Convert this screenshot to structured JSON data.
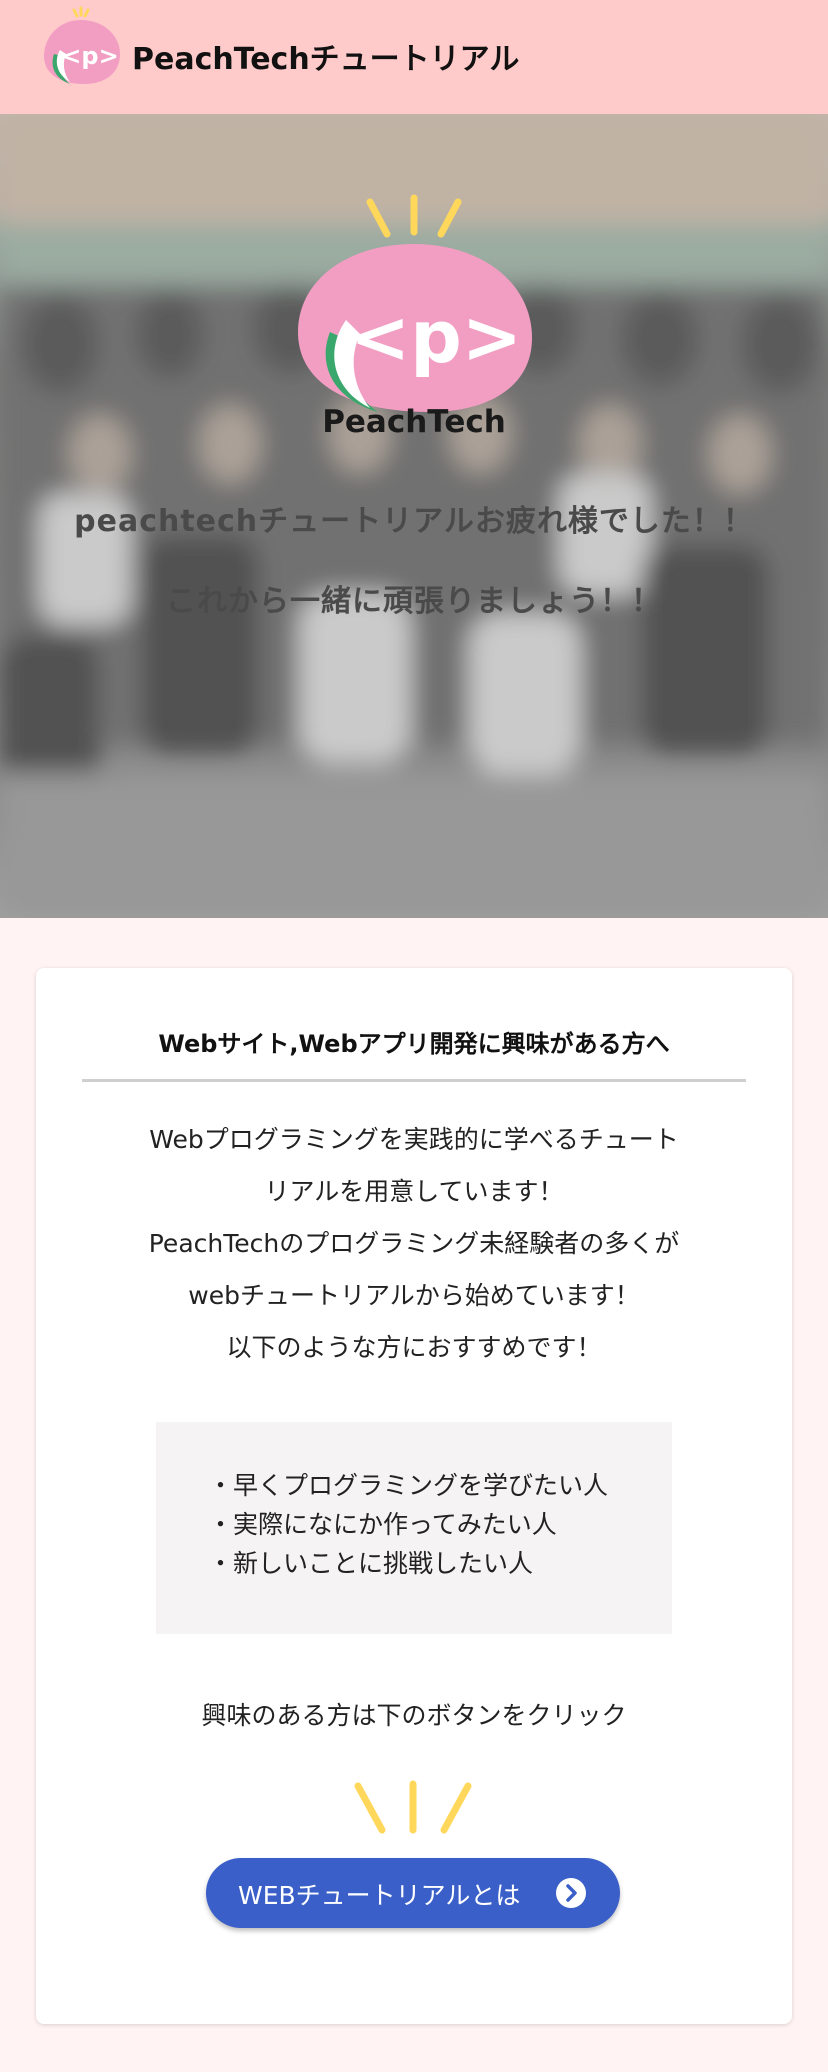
{
  "header": {
    "logo_text": "<p>",
    "title": "PeachTechチュートリアル"
  },
  "hero": {
    "logo_text": "<p>",
    "brand": "PeachTech",
    "message_line1": "peachtechチュートリアルお疲れ様でした！！",
    "message_line2": "これから一緒に頑張りましょう！！"
  },
  "card": {
    "title": "Webサイト,Webアプリ開発に興味がある方へ",
    "description": [
      "Webプログラミングを実践的に学べるチュート",
      "リアルを用意しています！",
      "PeachTechのプログラミング未経験者の多くが",
      "webチュートリアルから始めています！",
      "以下のような方におすすめです！"
    ],
    "recommend_items": [
      "・早くプログラミングを学びたい人",
      "・実際になにか作ってみたい人",
      "・新しいことに挑戦したい人"
    ],
    "cta_text": "興味のある方は下のボタンをクリック",
    "button_label": "WEBチュートリアルとは",
    "button_icon": "chevron-right-circle-icon"
  },
  "colors": {
    "header_bg": "#ffcaca",
    "page_bg": "#fff3f3",
    "peach": "#f29ec3",
    "leaf": "#3aa76d",
    "sparkle": "#ffd75a",
    "button": "#3a5fc8"
  }
}
